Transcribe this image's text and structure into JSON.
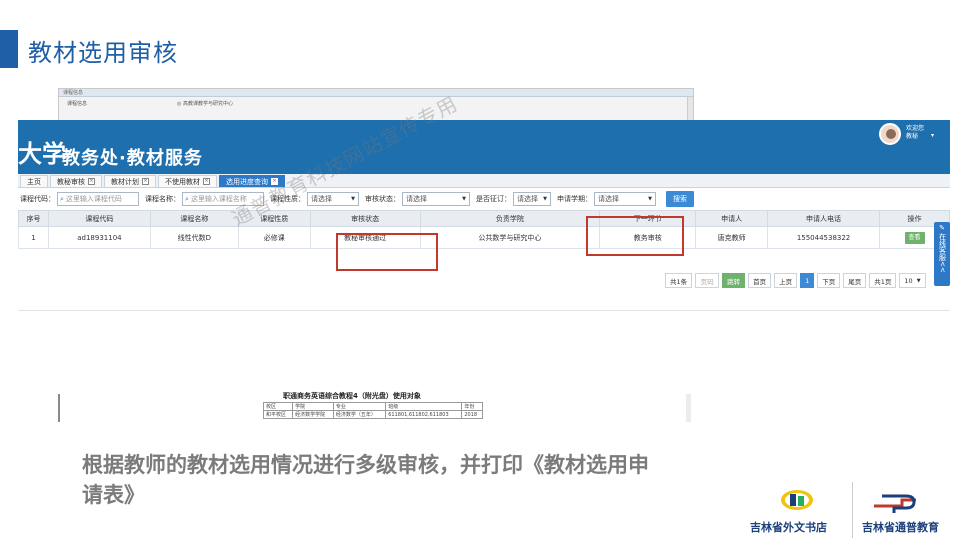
{
  "slide": {
    "title": "教材选用审核",
    "caption": "根据教师的教材选用情况进行多级审核，并打印《教材选用申请表》",
    "watermark": "通普教育科技网站宣传专用"
  },
  "background_dialog": {
    "title": "课程信息",
    "row_left": "课程信息",
    "row_right": "◎ 高教课教学与研究中心"
  },
  "app": {
    "logo_text": "大学",
    "system_title": "教务处·教材服务",
    "welcome_line1": "欢迎您",
    "welcome_line2": "教秘",
    "tabs": [
      {
        "label": "主页"
      },
      {
        "label": "教秘审核"
      },
      {
        "label": "教材计划"
      },
      {
        "label": "不使用教材"
      },
      {
        "label": "选用进度查询"
      }
    ],
    "filters": {
      "course_code_label": "课程代码：",
      "course_code_placeholder": "这里输入课程代码",
      "course_name_label": "课程名称：",
      "course_name_placeholder": "这里输入课程名称",
      "course_nature_label": "课程性质：",
      "course_nature_value": "请选择",
      "audit_status_label": "审核状态：",
      "audit_status_value": "请选择",
      "ordered_label": "是否征订：",
      "ordered_value": "请选择",
      "term_label": "申请学期：",
      "term_value": "请选择",
      "search_label": "搜索"
    },
    "table": {
      "headers": [
        "序号",
        "课程代码",
        "课程名称",
        "课程性质",
        "审核状态",
        "负责学院",
        "下一环节",
        "申请人",
        "申请人电话",
        "操作"
      ],
      "rows": [
        {
          "no": "1",
          "course_code": "ad18931104",
          "course_name": "线性代数D",
          "course_nature": "必修课",
          "audit_status": "教秘审核通过",
          "college": "公共数学与研究中心",
          "next_step": "教务审核",
          "applicant": "唐克教师",
          "phone": "15504453832​2",
          "action": "查看"
        }
      ]
    },
    "pager": {
      "total": "共1条",
      "page_input_placeholder": "页码",
      "goto": "跳转",
      "first": "首页",
      "prev": "上页",
      "current": "1",
      "next": "下页",
      "last": "尾页",
      "total_pages": "共1页",
      "page_size": "10"
    },
    "online_service": "在线客服<<"
  },
  "document": {
    "title": "职通商务英语综合教程4（附光盘）使用对象",
    "rows": [
      [
        "校区",
        "学院",
        "专业",
        "班级",
        "年份"
      ],
      [
        "和平校区",
        "经济数学学院",
        "经济数学（五年）",
        "611801,611802,611803",
        "2018"
      ]
    ]
  },
  "logos": {
    "left_text": "吉林省外文书店",
    "right_text": "吉林省通普教育"
  },
  "colors": {
    "brand_blue": "#1f5fa8",
    "header_blue": "#1e6fae",
    "highlight_red": "#c0392b",
    "caption_gray": "#7b7b7b"
  }
}
